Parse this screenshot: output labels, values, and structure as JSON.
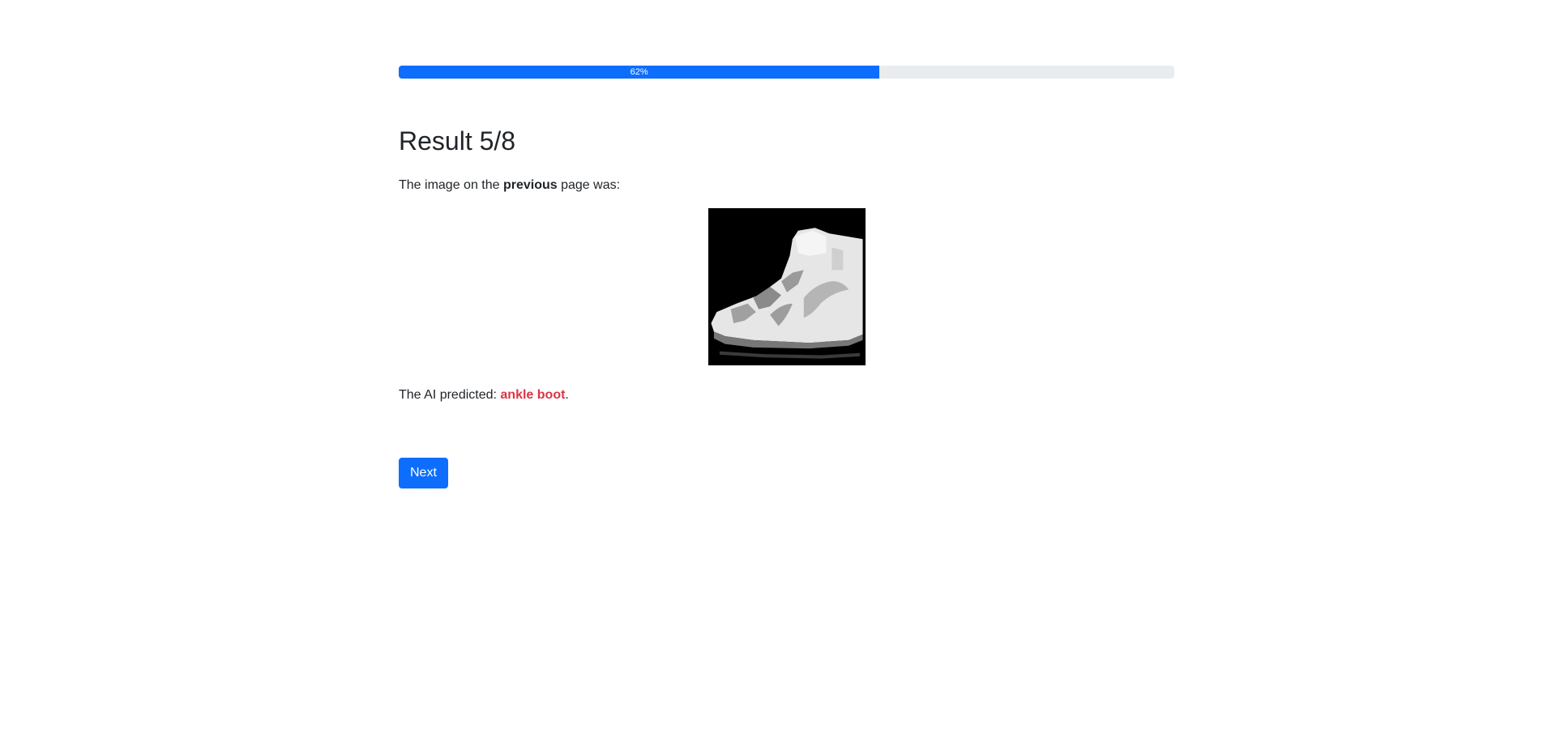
{
  "progress": {
    "value": 0.62,
    "label": "62%",
    "color": "#0d6efd"
  },
  "result": {
    "title": "Result 5/8",
    "intro_before": "The image on the ",
    "intro_bold": "previous",
    "intro_after": " page was:",
    "image_icon": "sneaker-image",
    "prediction_prefix": "The AI predicted: ",
    "prediction": "ankle boot",
    "prediction_suffix": ".",
    "prediction_color": "#dc3545"
  },
  "actions": {
    "next_label": "Next"
  }
}
